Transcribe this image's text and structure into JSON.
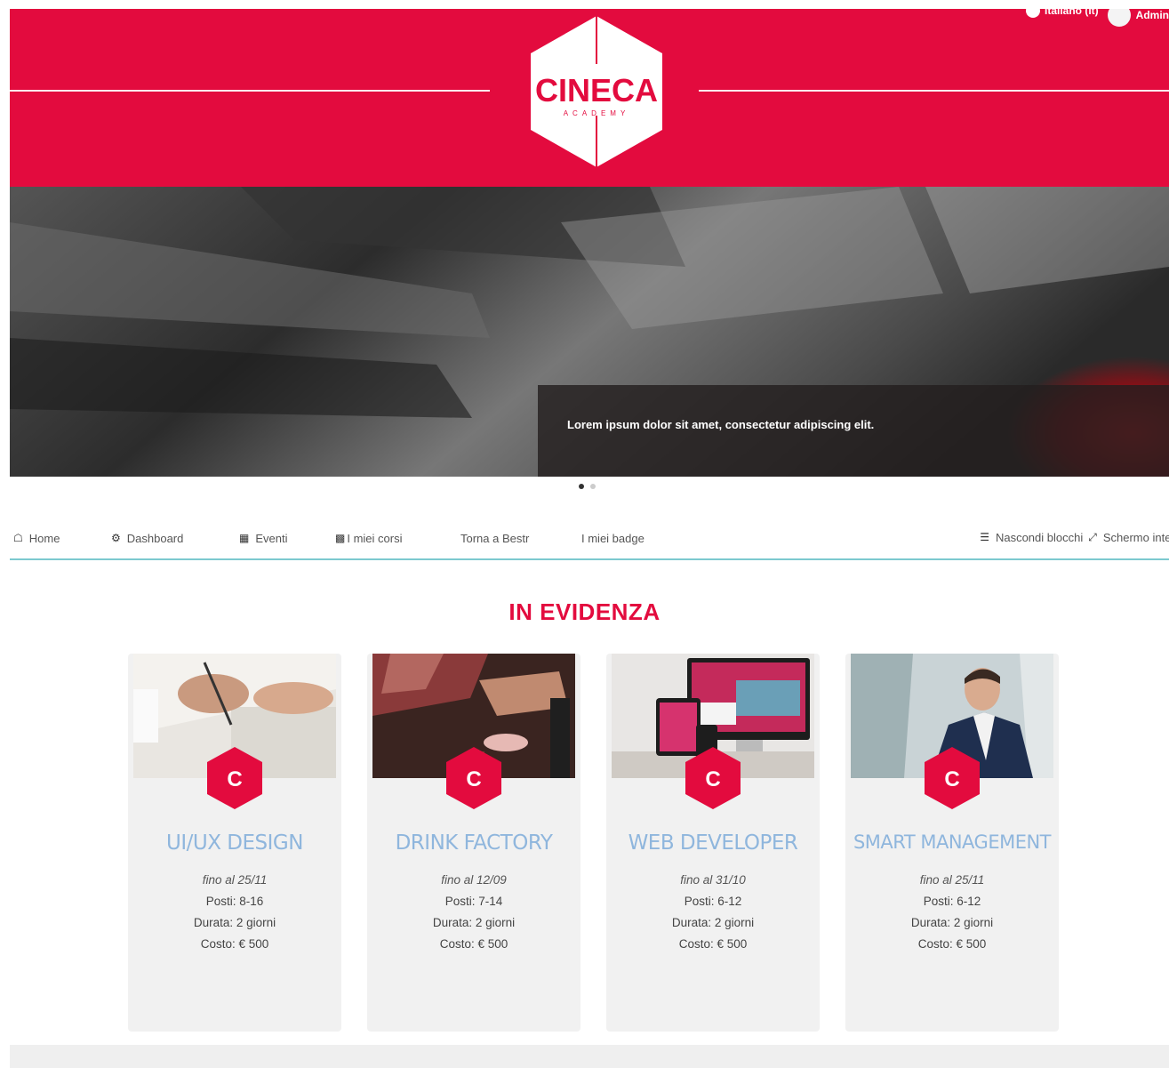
{
  "header": {
    "logo_text": "CINECA",
    "logo_subtext": "ACADEMY",
    "language": "Italiano (it)",
    "user": "Admin"
  },
  "hero": {
    "caption": "Lorem ipsum dolor sit amet, consectetur adipiscing elit.",
    "slides_count": 2,
    "active_slide": 1
  },
  "nav": {
    "items": [
      {
        "label": "Home",
        "icon": "home-icon"
      },
      {
        "label": "Dashboard",
        "icon": "dashboard-icon"
      },
      {
        "label": "Eventi",
        "icon": "calendar-icon"
      },
      {
        "label": "I miei corsi",
        "icon": "briefcase-icon"
      },
      {
        "label": "Torna a Bestr",
        "icon": ""
      },
      {
        "label": "I miei badge",
        "icon": ""
      }
    ],
    "hide_blocks": "Nascondi blocchi",
    "fullscreen": "Schermo intero"
  },
  "section": {
    "title": "IN EVIDENZA"
  },
  "courses": [
    {
      "title": "UI/UX DESIGN",
      "until": "fino al 25/11",
      "seats": "Posti: 8-16",
      "duration": "Durata: 2 giorni",
      "cost": "Costo: € 500"
    },
    {
      "title": "DRINK FACTORY",
      "until": "fino al 12/09",
      "seats": "Posti: 7-14",
      "duration": "Durata: 2 giorni",
      "cost": "Costo: € 500"
    },
    {
      "title": "WEB DEVELOPER",
      "until": "fino al 31/10",
      "seats": "Posti: 6-12",
      "duration": "Durata: 2 giorni",
      "cost": "Costo: € 500"
    },
    {
      "title": "SMART MANAGEMENT",
      "until": "fino al 25/11",
      "seats": "Posti: 6-12",
      "duration": "Durata: 2 giorni",
      "cost": "Costo: € 500"
    }
  ],
  "colors": {
    "brand": "#e30b3e",
    "card_title": "#8fb6dd",
    "nav_underline": "#7cc9cf"
  }
}
